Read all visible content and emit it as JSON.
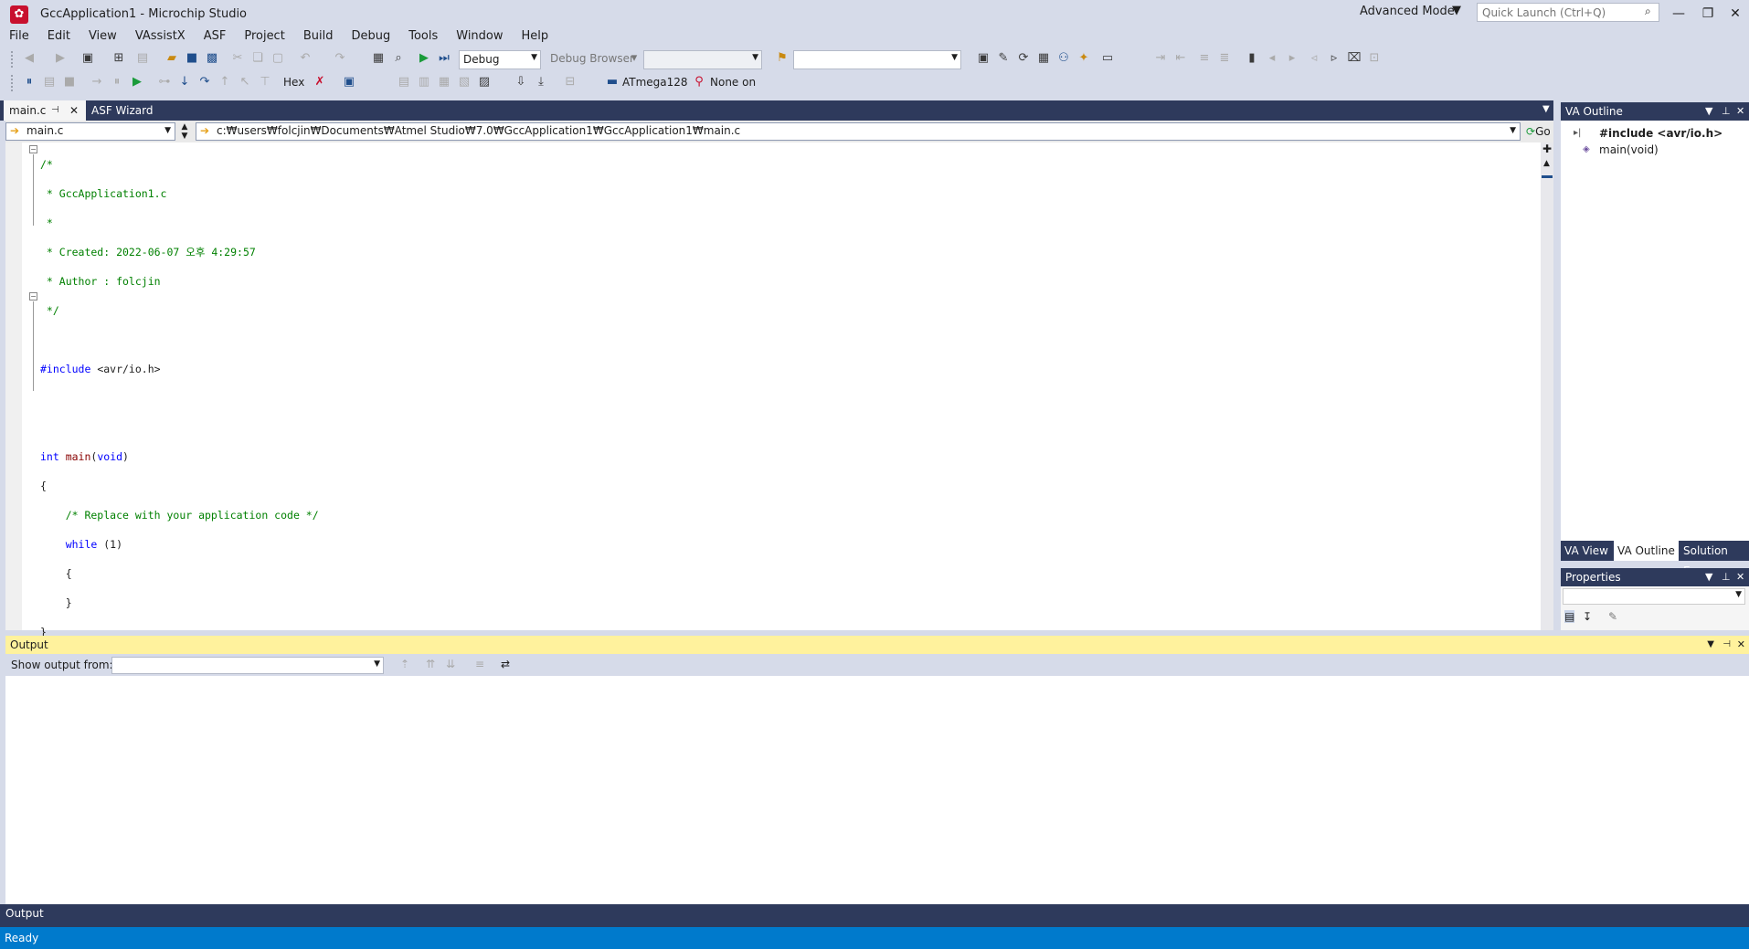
{
  "window": {
    "title": "GccApplication1 - Microchip Studio",
    "advanced_mode": "Advanced Mode",
    "quick_launch_placeholder": "Quick Launch (Ctrl+Q)"
  },
  "menu": [
    "File",
    "Edit",
    "View",
    "VAssistX",
    "ASF",
    "Project",
    "Build",
    "Debug",
    "Tools",
    "Window",
    "Help"
  ],
  "toolbar1": {
    "config_dropdown": "Debug",
    "debug_browser": "Debug Browser"
  },
  "toolbar2": {
    "hex_label": "Hex",
    "device": "ATmega128",
    "tool": "None on"
  },
  "tabs": [
    {
      "label": "main.c",
      "active": true
    },
    {
      "label": "ASF Wizard",
      "active": false
    }
  ],
  "nav": {
    "file": "main.c",
    "path": "c:₩users₩folcjin₩Documents₩Atmel Studio₩7.0₩GccApplication1₩GccApplication1₩main.c",
    "go": "Go"
  },
  "code": {
    "l1": "/*",
    "l2": " * GccApplication1.c",
    "l3": " *",
    "l4": " * Created: 2022-06-07 오후 4:29:57",
    "l5": " * Author : folcjin",
    "l6": " */",
    "l8": "#include",
    "l8b": " <avr/io.h>",
    "l11a": "int",
    "l11b": " main",
    "l11c": "(",
    "l11d": "void",
    "l11e": ")",
    "l12": "{",
    "l13": "    /* Replace with your application code */",
    "l14a": "    while",
    "l14b": " (1)",
    "l15": "    {",
    "l16": "    }",
    "l17": "}"
  },
  "va_outline": {
    "title": "VA Outline",
    "items": [
      "#include <avr/io.h>",
      "main(void)"
    ],
    "tabs": [
      "VA View",
      "VA Outline",
      "Solution E..."
    ]
  },
  "properties": {
    "title": "Properties"
  },
  "output": {
    "title": "Output",
    "show_from_label": "Show output from:",
    "bottom_tab": "Output"
  },
  "status": {
    "text": "Ready"
  },
  "colors": {
    "accent": "#007acc",
    "header": "#2e3a5c",
    "output_header": "#fff29d"
  }
}
